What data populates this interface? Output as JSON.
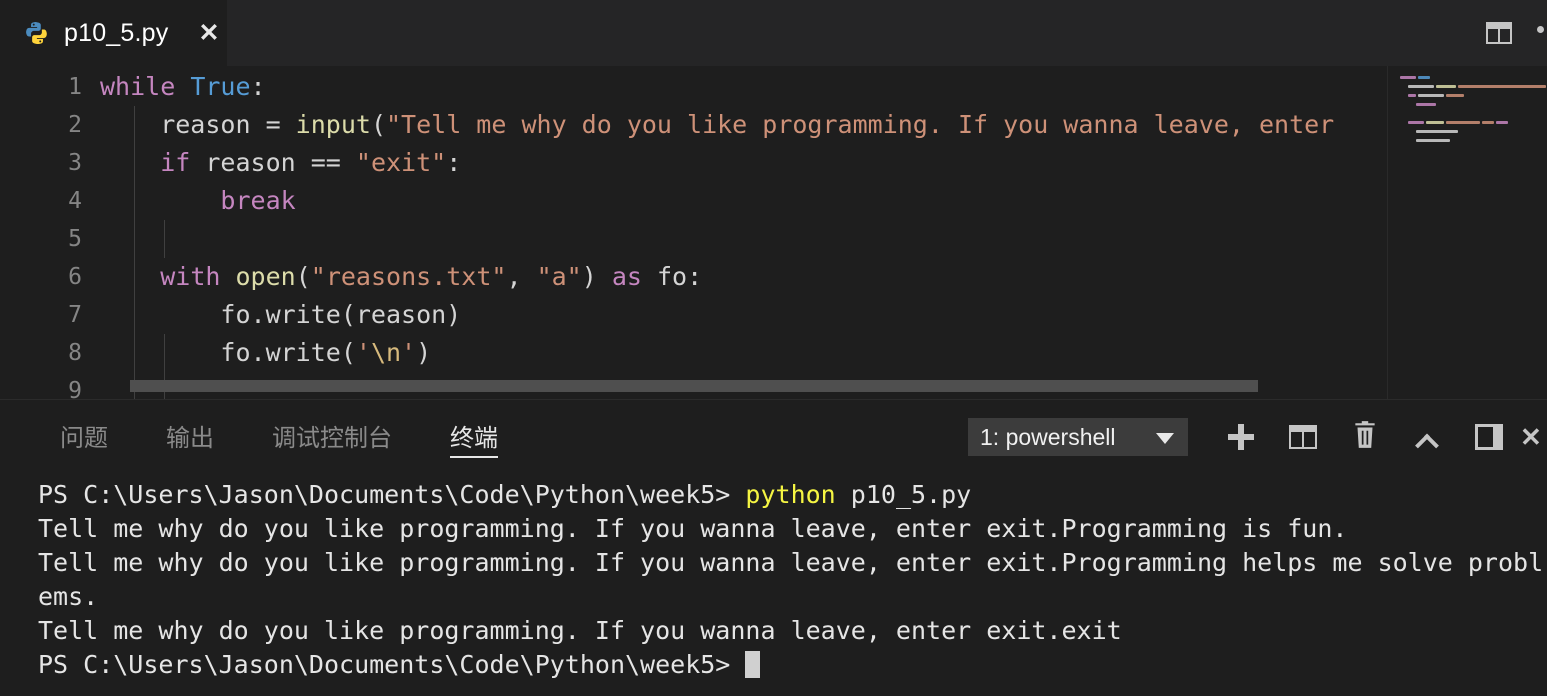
{
  "editor": {
    "tab": {
      "filename": "p10_5.py",
      "icon": "python-icon",
      "close_icon": "close-icon"
    },
    "actions": [
      {
        "name": "split-editor-button",
        "icon": "split-editor-icon"
      },
      {
        "name": "more-actions-button",
        "icon": "ellipsis-icon"
      }
    ],
    "line_numbers": [
      "1",
      "2",
      "3",
      "4",
      "5",
      "6",
      "7",
      "8",
      "9"
    ],
    "code_lines": [
      {
        "num": "1",
        "tokens": [
          {
            "t": "while",
            "c": "kw"
          },
          {
            "t": " ",
            "c": "pl"
          },
          {
            "t": "True",
            "c": "cst"
          },
          {
            "t": ":",
            "c": "pl"
          }
        ]
      },
      {
        "num": "2",
        "tokens": [
          {
            "t": "    reason = ",
            "c": "pl"
          },
          {
            "t": "input",
            "c": "fn"
          },
          {
            "t": "(",
            "c": "pl"
          },
          {
            "t": "\"Tell me why do you like programming. If you wanna leave, enter",
            "c": "str"
          }
        ]
      },
      {
        "num": "3",
        "tokens": [
          {
            "t": "    ",
            "c": "pl"
          },
          {
            "t": "if",
            "c": "kw"
          },
          {
            "t": " reason == ",
            "c": "pl"
          },
          {
            "t": "\"exit\"",
            "c": "str"
          },
          {
            "t": ":",
            "c": "pl"
          }
        ]
      },
      {
        "num": "4",
        "tokens": [
          {
            "t": "        ",
            "c": "pl"
          },
          {
            "t": "break",
            "c": "kw"
          }
        ]
      },
      {
        "num": "5",
        "tokens": []
      },
      {
        "num": "6",
        "tokens": [
          {
            "t": "    ",
            "c": "pl"
          },
          {
            "t": "with",
            "c": "kw"
          },
          {
            "t": " ",
            "c": "pl"
          },
          {
            "t": "open",
            "c": "fn"
          },
          {
            "t": "(",
            "c": "pl"
          },
          {
            "t": "\"reasons.txt\"",
            "c": "str"
          },
          {
            "t": ", ",
            "c": "pl"
          },
          {
            "t": "\"a\"",
            "c": "str"
          },
          {
            "t": ") ",
            "c": "pl"
          },
          {
            "t": "as",
            "c": "kw"
          },
          {
            "t": " fo:",
            "c": "pl"
          }
        ]
      },
      {
        "num": "7",
        "tokens": [
          {
            "t": "        fo.write(reason)",
            "c": "pl"
          }
        ]
      },
      {
        "num": "8",
        "tokens": [
          {
            "t": "        fo.write(",
            "c": "pl"
          },
          {
            "t": "'",
            "c": "str"
          },
          {
            "t": "\\n",
            "c": "esc"
          },
          {
            "t": "'",
            "c": "str"
          },
          {
            "t": ")",
            "c": "pl"
          }
        ]
      },
      {
        "num": "9",
        "tokens": []
      }
    ]
  },
  "panel": {
    "tabs": [
      {
        "label": "问题",
        "name": "tab-problems",
        "active": false
      },
      {
        "label": "输出",
        "name": "tab-output",
        "active": false
      },
      {
        "label": "调试控制台",
        "name": "tab-debug-console",
        "active": false
      },
      {
        "label": "终端",
        "name": "tab-terminal",
        "active": true
      }
    ],
    "terminal_selector": {
      "value": "1: powershell",
      "caret_icon": "chevron-down-icon"
    },
    "actions": [
      {
        "name": "new-terminal-button",
        "icon": "plus-icon"
      },
      {
        "name": "split-terminal-button",
        "icon": "split-icon"
      },
      {
        "name": "kill-terminal-button",
        "icon": "trash-icon"
      },
      {
        "name": "collapse-panel-button",
        "icon": "chevron-up-icon"
      },
      {
        "name": "maximize-panel-button",
        "icon": "maximize-icon"
      },
      {
        "name": "close-panel-button",
        "icon": "close-icon"
      }
    ]
  },
  "terminal": {
    "lines": [
      {
        "type": "command",
        "prompt": "PS C:\\Users\\Jason\\Documents\\Code\\Python\\week5> ",
        "cmd": "python",
        "args": " p10_5.py"
      },
      {
        "type": "output",
        "text": "Tell me why do you like programming. If you wanna leave, enter exit.Programming is fun."
      },
      {
        "type": "output",
        "text": "Tell me why do you like programming. If you wanna leave, enter exit.Programming helps me solve probl"
      },
      {
        "type": "output",
        "text": "ems."
      },
      {
        "type": "output",
        "text": "Tell me why do you like programming. If you wanna leave, enter exit.exit"
      },
      {
        "type": "prompt",
        "text": "PS C:\\Users\\Jason\\Documents\\Code\\Python\\week5> "
      }
    ]
  },
  "colors": {
    "background": "#1e1e1e",
    "tabbar": "#252526",
    "keyword": "#c586c0",
    "constant": "#569cd6",
    "function": "#dcdcaa",
    "string": "#ce9178",
    "escape": "#d7ba7d",
    "terminal_yellow": "#f5f543"
  }
}
